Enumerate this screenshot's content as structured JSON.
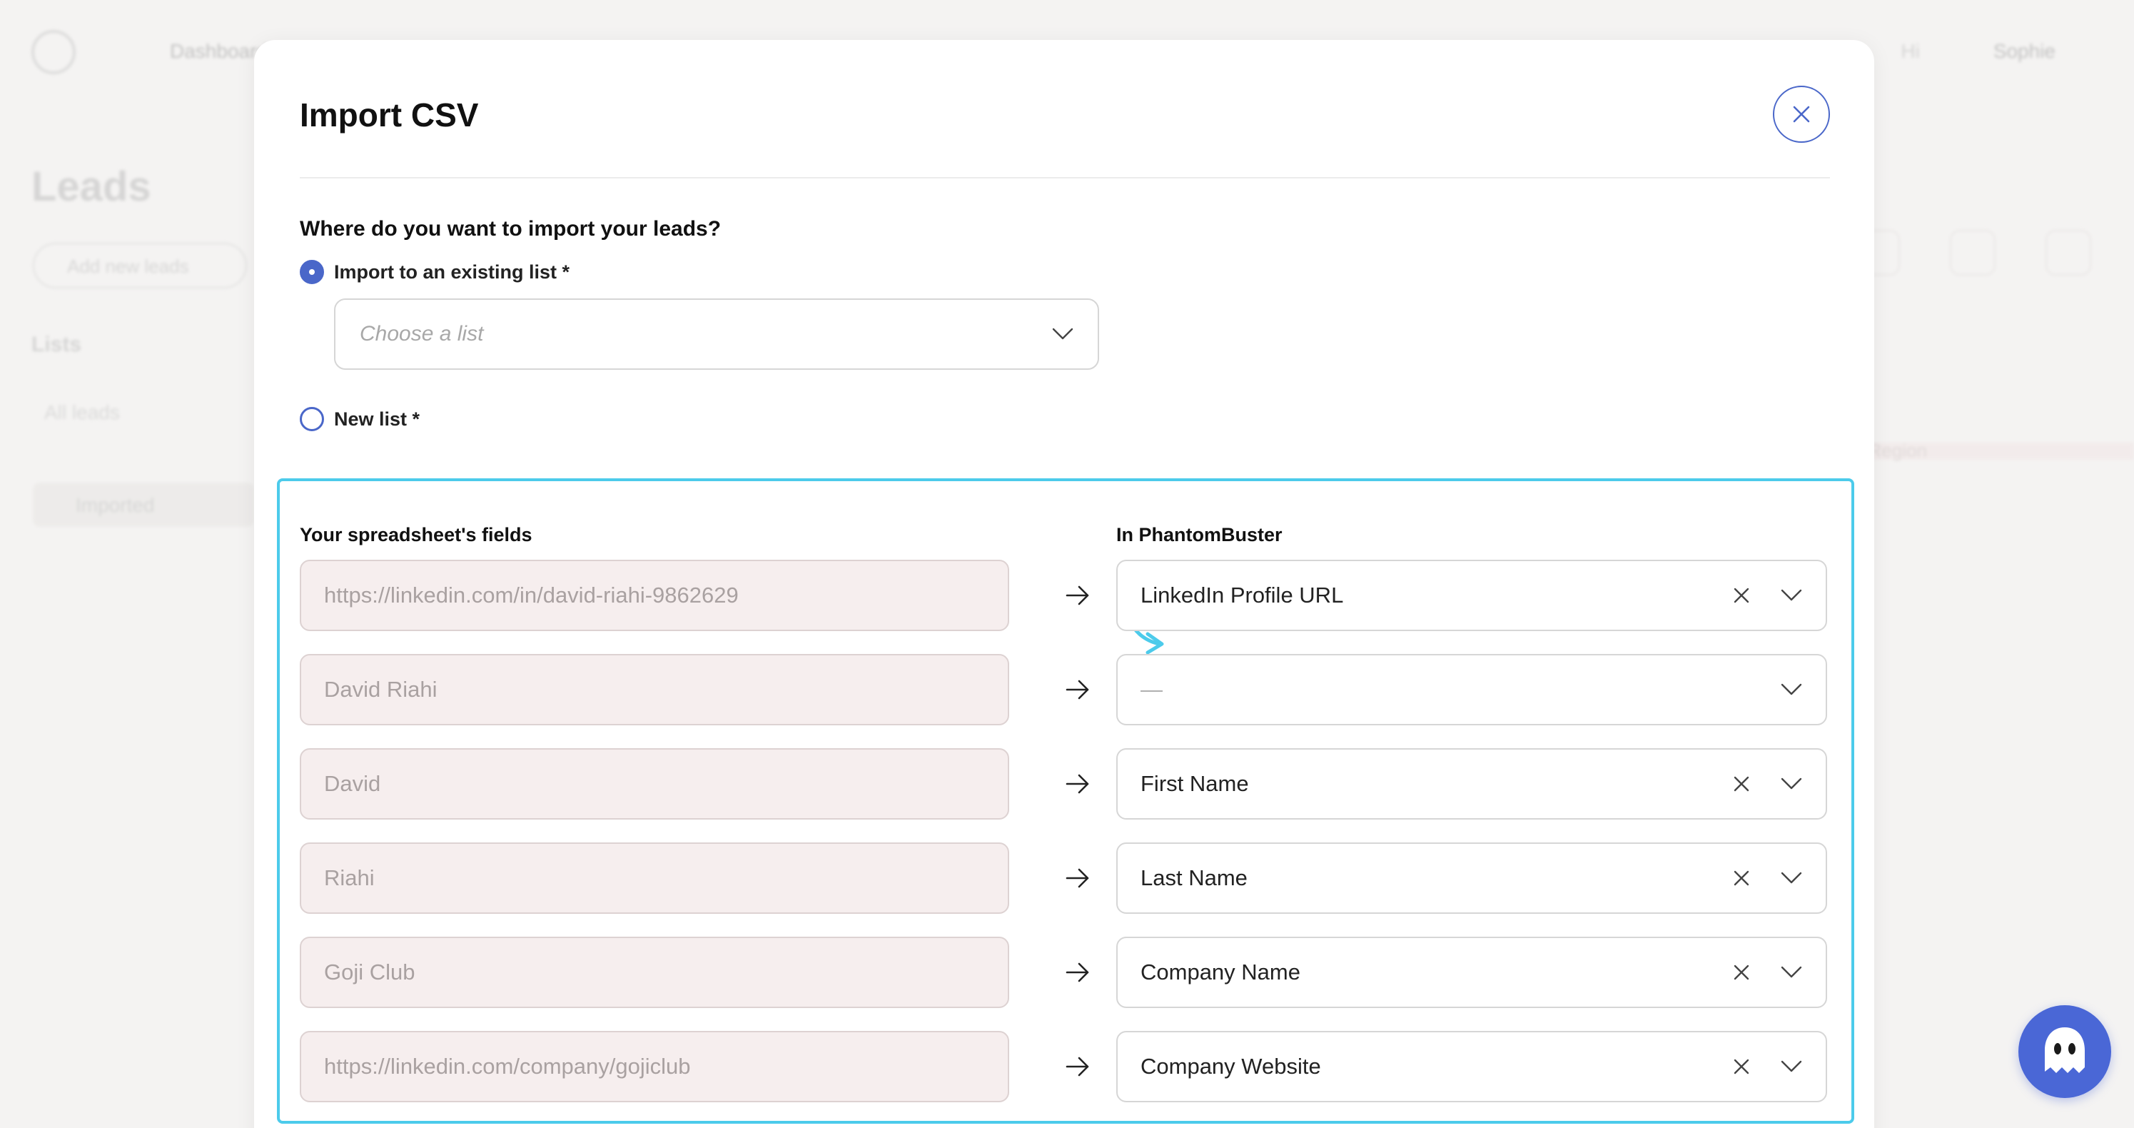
{
  "background": {
    "nav_label": "Dashboard",
    "page_title": "Leads",
    "add_button": "Add new leads",
    "lists_heading": "Lists",
    "all_leads": "All leads",
    "list_item": "Imported",
    "user_name": "Sophie",
    "user_link": "Hi",
    "table_col": "Region"
  },
  "modal": {
    "title": "Import CSV",
    "question": "Where do you want to import your leads?",
    "option_existing": "Import to an existing list *",
    "list_placeholder": "Choose a list",
    "option_new": "New list *",
    "col_source": "Your spreadsheet's fields",
    "col_target": "In PhantomBuster",
    "rows": [
      {
        "source": "https://linkedin.com/in/david-riahi-9862629",
        "target": "LinkedIn Profile URL",
        "clearable": true
      },
      {
        "source": "David Riahi",
        "target": "—",
        "clearable": false
      },
      {
        "source": "David",
        "target": "First Name",
        "clearable": true
      },
      {
        "source": "Riahi",
        "target": "Last Name",
        "clearable": true
      },
      {
        "source": "Goji Club",
        "target": "Company Name",
        "clearable": true
      },
      {
        "source": "https://linkedin.com/company/gojiclub",
        "target": "Company Website",
        "clearable": true
      }
    ]
  },
  "colors": {
    "accent": "#4a67c9",
    "highlight": "#4ccbeb",
    "source_bg": "#f6eeee"
  },
  "icons": {
    "close": "close-icon",
    "chevron": "chevron-down-icon",
    "arrow": "arrow-right-icon",
    "clear": "clear-x-icon",
    "chat": "ghost-icon"
  }
}
